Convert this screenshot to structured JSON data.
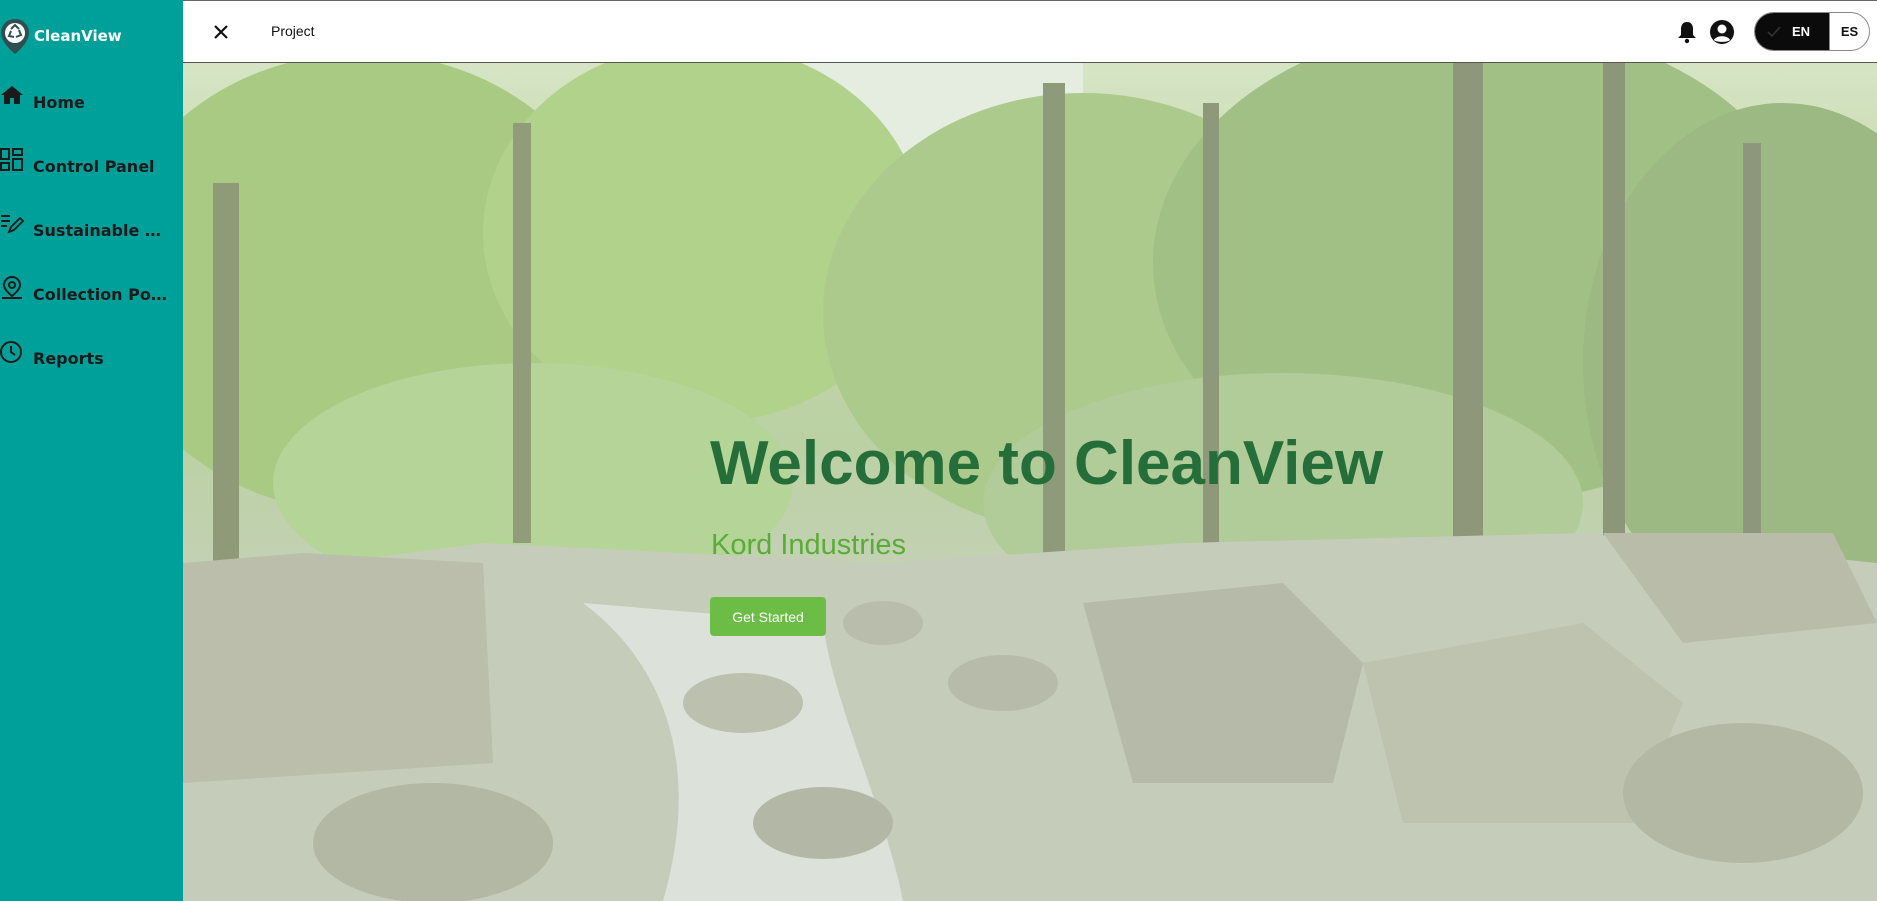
{
  "app": {
    "name": "CleanView"
  },
  "sidebar": {
    "items": [
      {
        "label": "Home",
        "icon": "home-icon"
      },
      {
        "label": "Control Panel",
        "icon": "dashboard-icon"
      },
      {
        "label": "Sustainable Act...",
        "icon": "edit-list-icon"
      },
      {
        "label": "Collection Points",
        "icon": "location-pin-icon"
      },
      {
        "label": "Reports",
        "icon": "clock-icon"
      }
    ]
  },
  "header": {
    "title": "Project",
    "close_icon": "close-icon",
    "notification_icon": "bell-icon",
    "account_icon": "account-circle-icon",
    "language": {
      "selected": "EN",
      "options": [
        "EN",
        "ES"
      ]
    }
  },
  "hero": {
    "heading": "Welcome to CleanView",
    "subheading": "Kord Industries",
    "cta_label": "Get Started"
  },
  "colors": {
    "sidebar_bg": "#00a09a",
    "heading": "#256e39",
    "subheading": "#5aac38",
    "cta_bg": "#6bbd45",
    "toggle_selected_bg": "#0b0b0b"
  }
}
